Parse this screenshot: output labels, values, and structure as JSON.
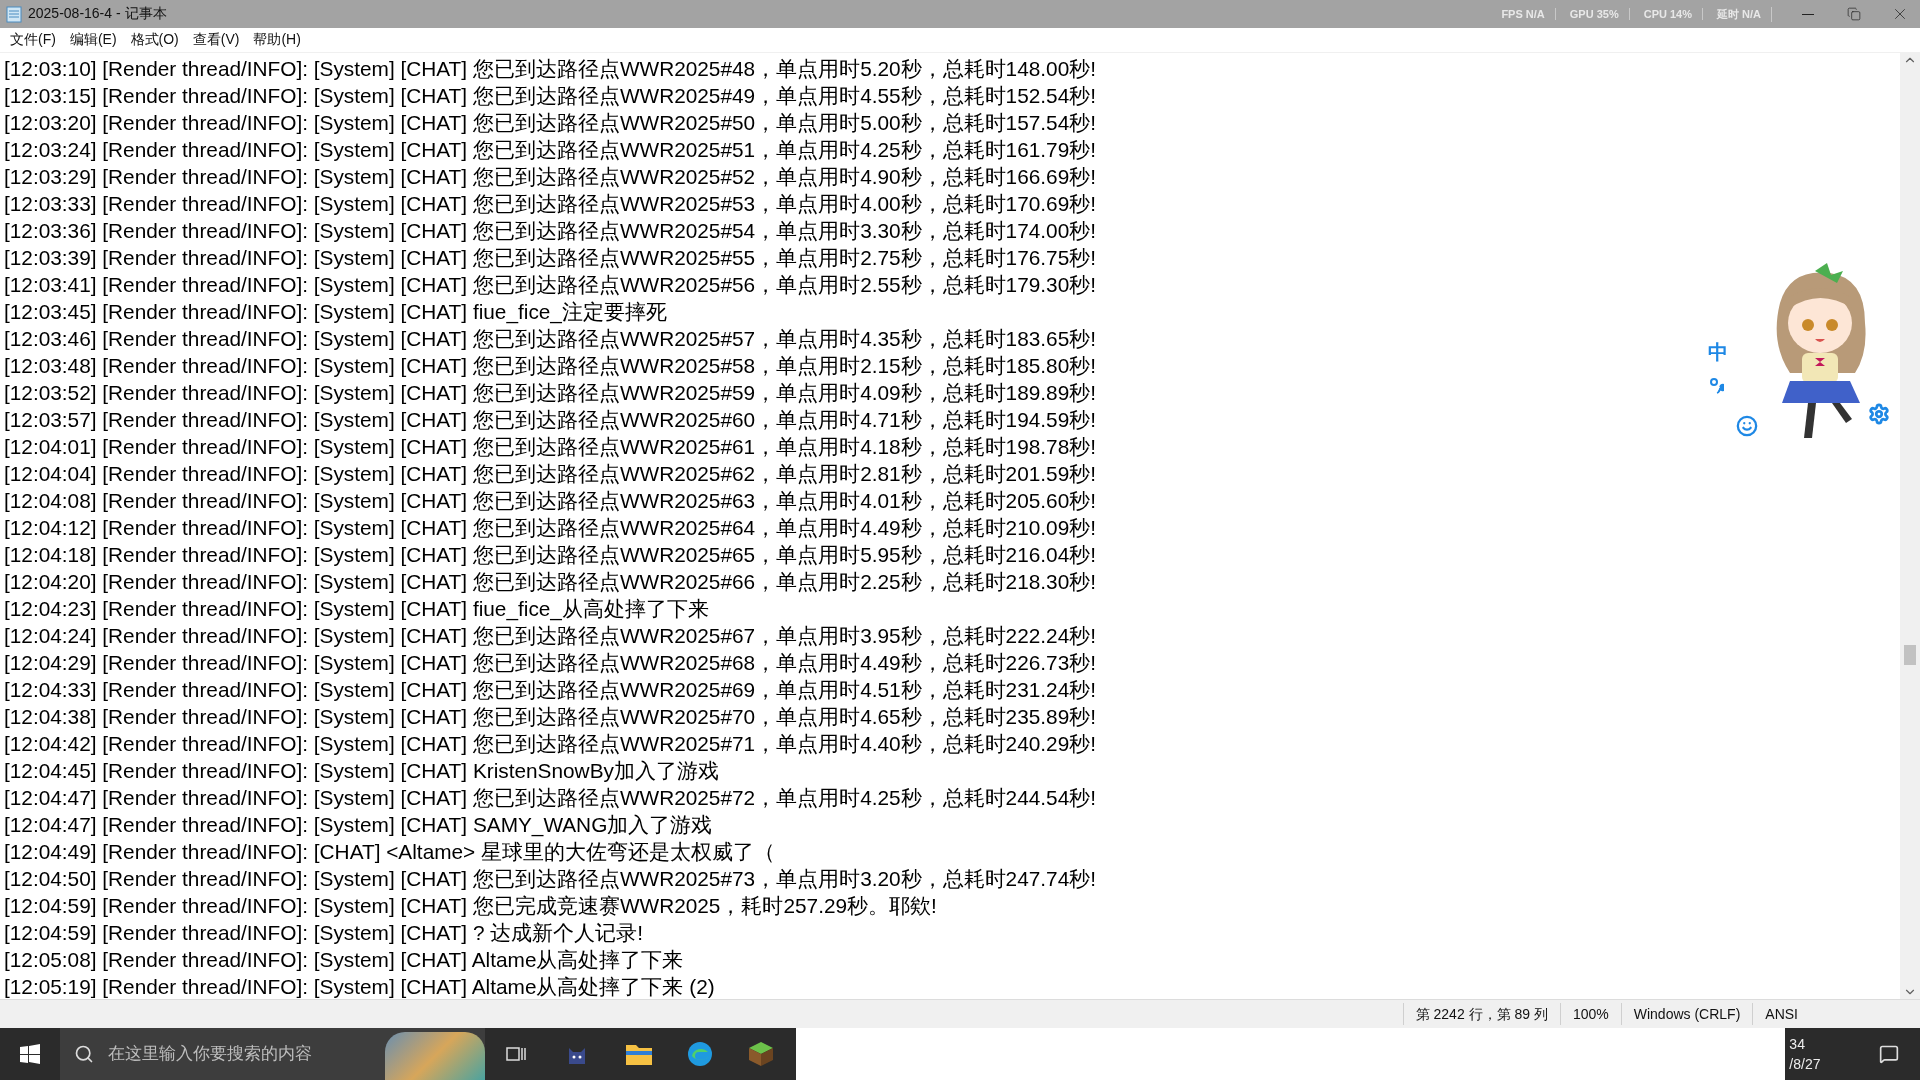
{
  "window": {
    "title": "2025-08-16-4 - 记事本"
  },
  "overlay_stats": [
    "FPS N/A",
    "GPU 35%",
    "CPU 14%",
    "延时 N/A"
  ],
  "menu": [
    "文件(F)",
    "编辑(E)",
    "格式(O)",
    "查看(V)",
    "帮助(H)"
  ],
  "lines": [
    "[12:03:10] [Render thread/INFO]: [System] [CHAT] 您已到达路径点WWR2025#48，单点用时5.20秒，总耗时148.00秒!",
    "[12:03:15] [Render thread/INFO]: [System] [CHAT] 您已到达路径点WWR2025#49，单点用时4.55秒，总耗时152.54秒!",
    "[12:03:20] [Render thread/INFO]: [System] [CHAT] 您已到达路径点WWR2025#50，单点用时5.00秒，总耗时157.54秒!",
    "[12:03:24] [Render thread/INFO]: [System] [CHAT] 您已到达路径点WWR2025#51，单点用时4.25秒，总耗时161.79秒!",
    "[12:03:29] [Render thread/INFO]: [System] [CHAT] 您已到达路径点WWR2025#52，单点用时4.90秒，总耗时166.69秒!",
    "[12:03:33] [Render thread/INFO]: [System] [CHAT] 您已到达路径点WWR2025#53，单点用时4.00秒，总耗时170.69秒!",
    "[12:03:36] [Render thread/INFO]: [System] [CHAT] 您已到达路径点WWR2025#54，单点用时3.30秒，总耗时174.00秒!",
    "[12:03:39] [Render thread/INFO]: [System] [CHAT] 您已到达路径点WWR2025#55，单点用时2.75秒，总耗时176.75秒!",
    "[12:03:41] [Render thread/INFO]: [System] [CHAT] 您已到达路径点WWR2025#56，单点用时2.55秒，总耗时179.30秒!",
    "[12:03:45] [Render thread/INFO]: [System] [CHAT] fiue_fice_注定要摔死",
    "[12:03:46] [Render thread/INFO]: [System] [CHAT] 您已到达路径点WWR2025#57，单点用时4.35秒，总耗时183.65秒!",
    "[12:03:48] [Render thread/INFO]: [System] [CHAT] 您已到达路径点WWR2025#58，单点用时2.15秒，总耗时185.80秒!",
    "[12:03:52] [Render thread/INFO]: [System] [CHAT] 您已到达路径点WWR2025#59，单点用时4.09秒，总耗时189.89秒!",
    "[12:03:57] [Render thread/INFO]: [System] [CHAT] 您已到达路径点WWR2025#60，单点用时4.71秒，总耗时194.59秒!",
    "[12:04:01] [Render thread/INFO]: [System] [CHAT] 您已到达路径点WWR2025#61，单点用时4.18秒，总耗时198.78秒!",
    "[12:04:04] [Render thread/INFO]: [System] [CHAT] 您已到达路径点WWR2025#62，单点用时2.81秒，总耗时201.59秒!",
    "[12:04:08] [Render thread/INFO]: [System] [CHAT] 您已到达路径点WWR2025#63，单点用时4.01秒，总耗时205.60秒!",
    "[12:04:12] [Render thread/INFO]: [System] [CHAT] 您已到达路径点WWR2025#64，单点用时4.49秒，总耗时210.09秒!",
    "[12:04:18] [Render thread/INFO]: [System] [CHAT] 您已到达路径点WWR2025#65，单点用时5.95秒，总耗时216.04秒!",
    "[12:04:20] [Render thread/INFO]: [System] [CHAT] 您已到达路径点WWR2025#66，单点用时2.25秒，总耗时218.30秒!",
    "[12:04:23] [Render thread/INFO]: [System] [CHAT] fiue_fice_从高处摔了下来",
    "[12:04:24] [Render thread/INFO]: [System] [CHAT] 您已到达路径点WWR2025#67，单点用时3.95秒，总耗时222.24秒!",
    "[12:04:29] [Render thread/INFO]: [System] [CHAT] 您已到达路径点WWR2025#68，单点用时4.49秒，总耗时226.73秒!",
    "[12:04:33] [Render thread/INFO]: [System] [CHAT] 您已到达路径点WWR2025#69，单点用时4.51秒，总耗时231.24秒!",
    "[12:04:38] [Render thread/INFO]: [System] [CHAT] 您已到达路径点WWR2025#70，单点用时4.65秒，总耗时235.89秒!",
    "[12:04:42] [Render thread/INFO]: [System] [CHAT] 您已到达路径点WWR2025#71，单点用时4.40秒，总耗时240.29秒!",
    "[12:04:45] [Render thread/INFO]: [System] [CHAT] KristenSnowBy加入了游戏",
    "[12:04:47] [Render thread/INFO]: [System] [CHAT] 您已到达路径点WWR2025#72，单点用时4.25秒，总耗时244.54秒!",
    "[12:04:47] [Render thread/INFO]: [System] [CHAT] SAMY_WANG加入了游戏",
    "[12:04:49] [Render thread/INFO]: [CHAT] <Altame> 星球里的大佐弯还是太权威了（",
    "[12:04:50] [Render thread/INFO]: [System] [CHAT] 您已到达路径点WWR2025#73，单点用时3.20秒，总耗时247.74秒!",
    "[12:04:59] [Render thread/INFO]: [System] [CHAT] 您已完成竞速赛WWR2025，耗时257.29秒。耶欸!",
    "[12:04:59] [Render thread/INFO]: [System] [CHAT] ? 达成新个人记录!",
    "[12:05:08] [Render thread/INFO]: [System] [CHAT] Altame从高处摔了下来",
    "[12:05:19] [Render thread/INFO]: [System] [CHAT] Altame从高处摔了下来 (2)"
  ],
  "ime": {
    "mode": "中"
  },
  "status_bar": [
    "第 2242 行，第 89 列",
    "100%",
    "Windows (CRLF)",
    "ANSI"
  ],
  "taskbar": {
    "search": {
      "placeholder": "在这里输入你要搜索的内容"
    },
    "clock": [
      "34",
      "/8/27"
    ]
  }
}
